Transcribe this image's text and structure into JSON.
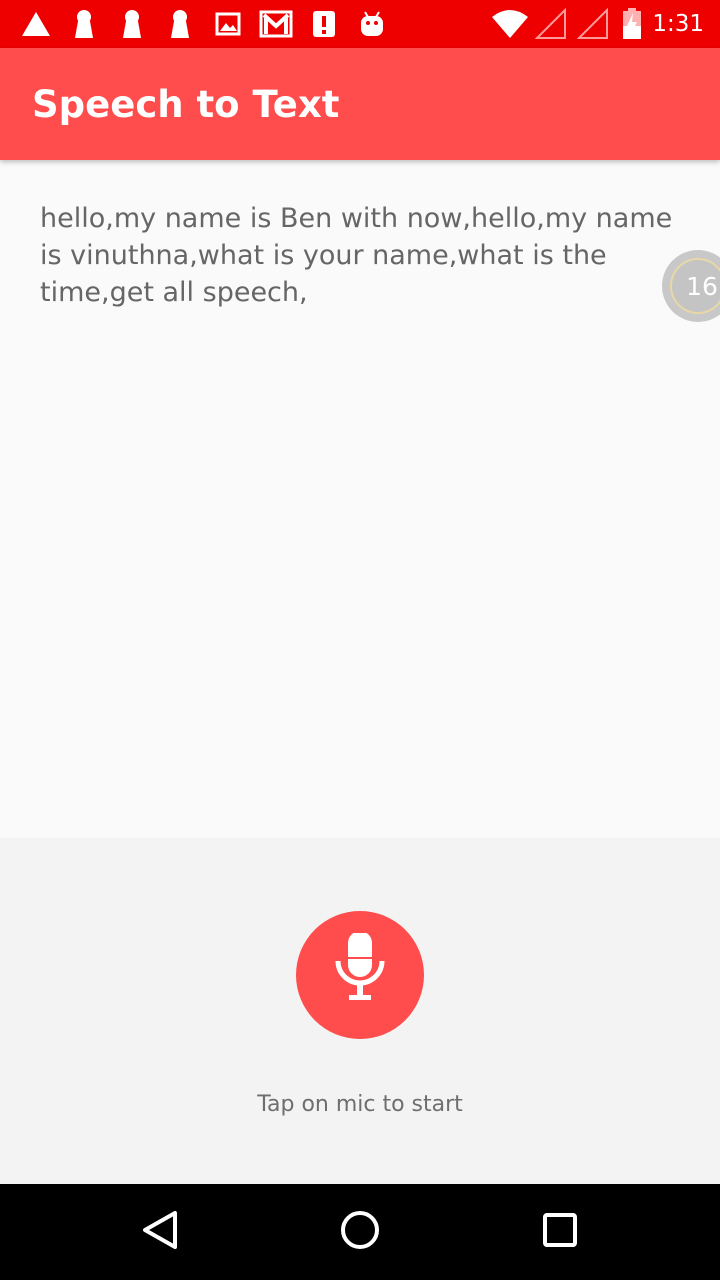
{
  "status_bar": {
    "time": "1:31",
    "background": "#ee0000",
    "left_icons": [
      "warning-icon",
      "keyhole-icon",
      "keyhole-icon",
      "keyhole-icon",
      "image-icon",
      "gmail-icon",
      "alert-icon",
      "android-icon"
    ],
    "right_icons": [
      "wifi-icon",
      "signal-empty-icon",
      "signal-empty-icon",
      "battery-charging-icon"
    ]
  },
  "app_bar": {
    "title": "Speech to Text",
    "background": "#ff4c4c"
  },
  "content": {
    "speech_text": "hello,my name is Ben with now,hello,my name is vinuthna,what is your name,what is the time,get all speech,",
    "floating_badge": "16"
  },
  "bottom_panel": {
    "mic_icon": "microphone-icon",
    "hint": "Tap on mic to start",
    "accent": "#ff4c4c"
  },
  "nav_bar": {
    "buttons": [
      "back-icon",
      "home-icon",
      "recents-icon"
    ]
  }
}
